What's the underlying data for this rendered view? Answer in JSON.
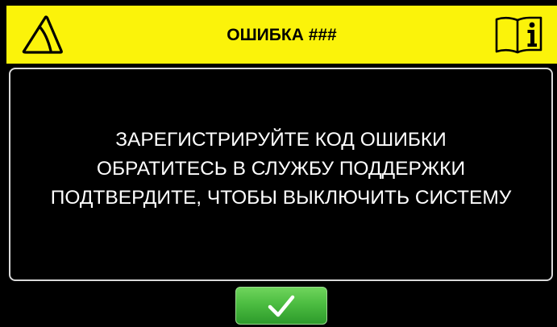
{
  "header": {
    "title": "ОШИБКА ###",
    "background_color": "#fbf30a",
    "left_icon": "warning-triangle-icon",
    "right_icon": "manual-info-icon",
    "indicator_color": "#e22a1e"
  },
  "message": {
    "lines": [
      "ЗАРЕГИСТРИРУЙТЕ КОД ОШИБКИ",
      "ОБРАТИТЕСЬ В СЛУЖБУ ПОДДЕРЖКИ",
      "ПОДТВЕРДИТЕ, ЧТОБЫ ВЫКЛЮЧИТЬ СИСТЕМУ"
    ],
    "text_color": "#ffffff",
    "border_color": "#d9d9d9"
  },
  "confirm_button": {
    "icon": "checkmark-icon",
    "color": "#4cbd41"
  }
}
